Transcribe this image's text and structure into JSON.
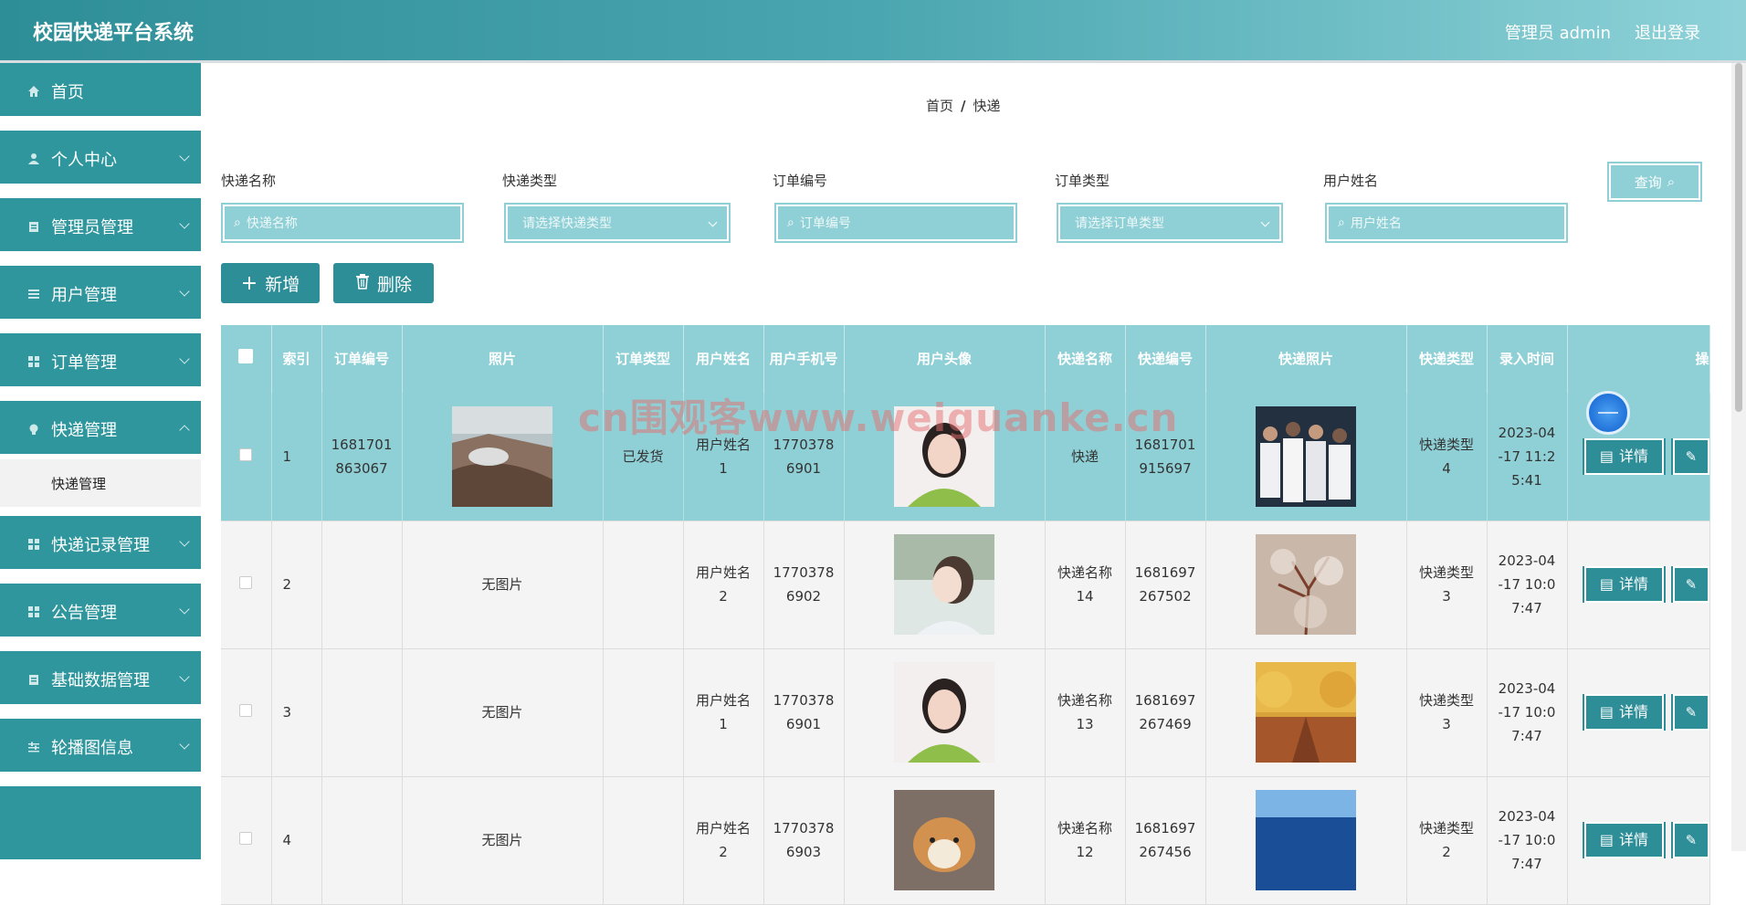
{
  "header": {
    "title": "校园快递平台系统",
    "user": "管理员 admin",
    "logout": "退出登录"
  },
  "sidebar": {
    "items": [
      {
        "label": "首页",
        "icon": "home-icon"
      },
      {
        "label": "个人中心",
        "icon": "user-icon"
      },
      {
        "label": "管理员管理",
        "icon": "clipboard-icon"
      },
      {
        "label": "用户管理",
        "icon": "list-icon"
      },
      {
        "label": "订单管理",
        "icon": "grid-icon"
      },
      {
        "label": "快递管理",
        "icon": "bulb-icon"
      },
      {
        "label": "快递记录管理",
        "icon": "grid-icon"
      },
      {
        "label": "公告管理",
        "icon": "grid-icon"
      },
      {
        "label": "基础数据管理",
        "icon": "clipboard-icon"
      },
      {
        "label": "轮播图信息",
        "icon": "sliders-icon"
      }
    ],
    "submenu": "快递管理"
  },
  "breadcrumb": {
    "home": "首页",
    "sep": "/",
    "current": "快递"
  },
  "filters": {
    "kuaidi_name": {
      "label": "快递名称",
      "placeholder": "快递名称"
    },
    "kuaidi_type": {
      "label": "快递类型",
      "placeholder": "请选择快递类型"
    },
    "order_no": {
      "label": "订单编号",
      "placeholder": "订单编号"
    },
    "order_type": {
      "label": "订单类型",
      "placeholder": "请选择订单类型"
    },
    "user_name": {
      "label": "用户姓名",
      "placeholder": "用户姓名"
    },
    "query": "查询"
  },
  "actions": {
    "add": "新增",
    "delete": "删除"
  },
  "table": {
    "headers": [
      "",
      "索引",
      "订单编号",
      "照片",
      "订单类型",
      "用户姓名",
      "用户手机号",
      "用户头像",
      "快递名称",
      "快递编号",
      "快递照片",
      "快递类型",
      "录入时间",
      "操"
    ],
    "rows": [
      {
        "index": "1",
        "order_no": "1681701863067",
        "photo": "",
        "order_type": "已发货",
        "user_name": "用户姓名1",
        "phone": "17703786901",
        "kd_name": "快递",
        "kd_no": "1681701915697",
        "kd_type": "快递类型4",
        "time": "2023-04-17 11:25:41"
      },
      {
        "index": "2",
        "order_no": "",
        "photo": "无图片",
        "order_type": "",
        "user_name": "用户姓名2",
        "phone": "17703786902",
        "kd_name": "快递名称14",
        "kd_no": "1681697267502",
        "kd_type": "快递类型3",
        "time": "2023-04-17 10:07:47"
      },
      {
        "index": "3",
        "order_no": "",
        "photo": "无图片",
        "order_type": "",
        "user_name": "用户姓名1",
        "phone": "17703786901",
        "kd_name": "快递名称13",
        "kd_no": "1681697267469",
        "kd_type": "快递类型3",
        "time": "2023-04-17 10:07:47"
      },
      {
        "index": "4",
        "order_no": "",
        "photo": "无图片",
        "order_type": "",
        "user_name": "用户姓名2",
        "phone": "17703786903",
        "kd_name": "快递名称12",
        "kd_no": "1681697267456",
        "kd_type": "快递类型2",
        "time": "2023-04-17 10:07:47"
      }
    ],
    "detail": "详情"
  },
  "watermark": "cn围观客www.weiguanke.cn",
  "colors": {
    "primary": "#2e8e98",
    "light": "#8fd0d6"
  }
}
